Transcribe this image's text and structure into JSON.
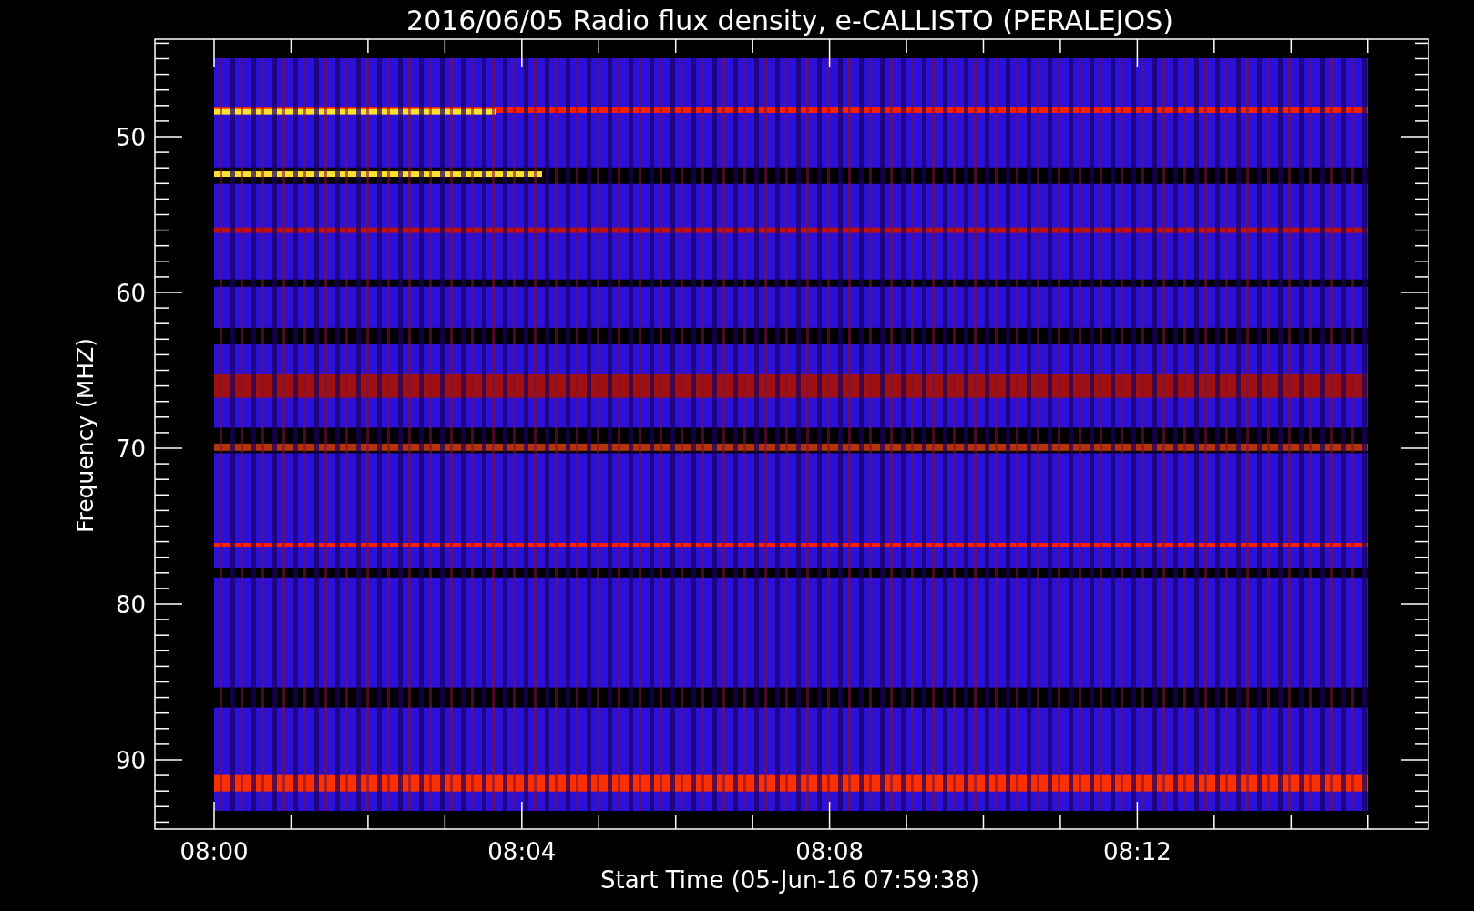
{
  "title": "2016/06/05  Radio flux density, e-CALLISTO (PERALEJOS)",
  "plot": {
    "ylabel": "Frequency (MHZ)",
    "xlabel": "Start Time (05-Jun-16 07:59:38)",
    "yticks": [
      "50",
      "60",
      "70",
      "80",
      "90"
    ],
    "xticks": [
      "08:00",
      "08:04",
      "08:08",
      "08:12"
    ]
  }
}
